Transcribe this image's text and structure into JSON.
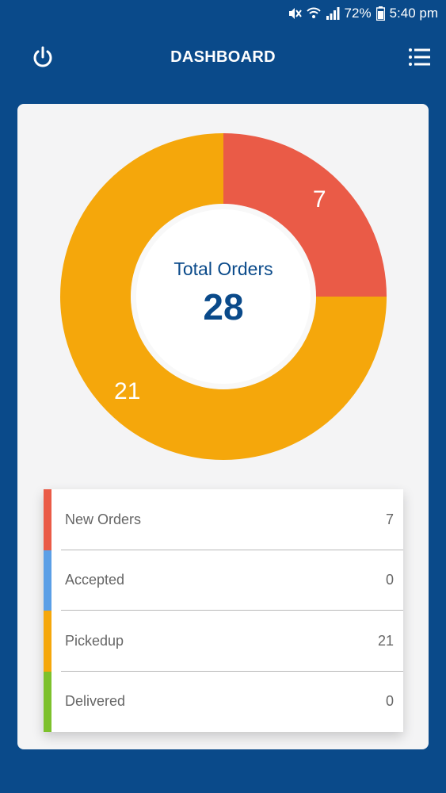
{
  "status_bar": {
    "battery": "72%",
    "time": "5:40 pm"
  },
  "header": {
    "title": "DASHBOARD",
    "power_icon": "power-icon",
    "menu_icon": "list-menu-icon"
  },
  "summary": {
    "label": "Total Orders",
    "total": "28"
  },
  "chart_data": {
    "type": "pie",
    "categories": [
      "New Orders",
      "Accepted",
      "Pickedup",
      "Delivered"
    ],
    "values": [
      7,
      0,
      21,
      0
    ],
    "colors": [
      "#ea5b47",
      "#5b9fe6",
      "#f5a70b",
      "#7dc12c"
    ],
    "slice_labels": [
      "7",
      "0",
      "21",
      "0"
    ]
  },
  "legend": {
    "items": [
      {
        "label": "New Orders",
        "count": "7",
        "color": "#ea5b47"
      },
      {
        "label": "Accepted",
        "count": "0",
        "color": "#5b9fe6"
      },
      {
        "label": "Pickedup",
        "count": "21",
        "color": "#f5a70b"
      },
      {
        "label": "Delivered",
        "count": "0",
        "color": "#7dc12c"
      }
    ]
  }
}
